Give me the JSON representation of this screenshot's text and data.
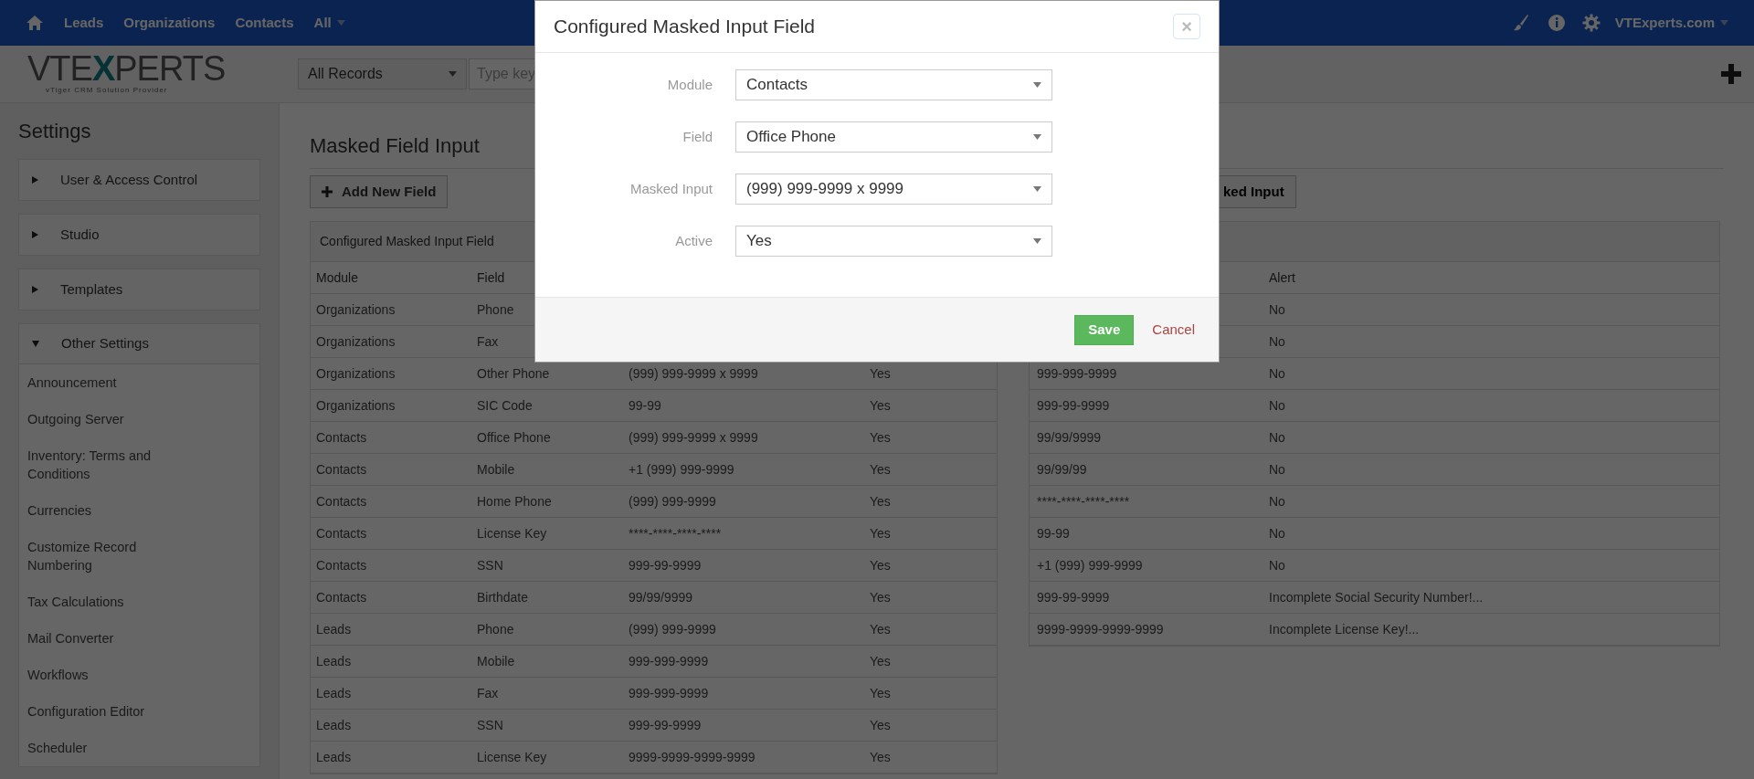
{
  "top_nav": {
    "links": [
      {
        "label": "Leads"
      },
      {
        "label": "Organizations"
      },
      {
        "label": "Contacts"
      },
      {
        "label": "All",
        "dropdown": true
      }
    ],
    "user_menu": "VTExperts.com"
  },
  "header_bar": {
    "logo": {
      "before": "VTE",
      "highlight": "X",
      "after": "PERTS",
      "tagline": "vTiger CRM Solution Provider"
    },
    "record_filter": "All Records",
    "search_placeholder": "Type key"
  },
  "sidebar": {
    "title": "Settings",
    "sections": [
      {
        "label": "User & Access Control",
        "expanded": false
      },
      {
        "label": "Studio",
        "expanded": false
      },
      {
        "label": "Templates",
        "expanded": false
      },
      {
        "label": "Other Settings",
        "expanded": true,
        "items": [
          "Announcement",
          "Outgoing Server",
          "Inventory: Terms and Conditions",
          "Currencies",
          "Customize Record Numbering",
          "Tax Calculations",
          "Mail Converter",
          "Workflows",
          "Configuration Editor",
          "Scheduler"
        ]
      }
    ]
  },
  "content": {
    "title": "Masked Field Input",
    "add_button": "Add New Field",
    "second_button": "ked Input",
    "left_table": {
      "heading": "Configured Masked Input Field",
      "columns": [
        "Module",
        "Field"
      ],
      "rows": [
        {
          "module": "Organizations",
          "field": "Phone"
        },
        {
          "module": "Organizations",
          "field": "Fax"
        },
        {
          "module": "Organizations",
          "field": "Other Phone",
          "column_3": "(999) 999-9999 x 9999",
          "column_4": "Yes"
        },
        {
          "module": "Organizations",
          "field": "SIC Code",
          "column_3": "99-99",
          "column_4": "Yes"
        },
        {
          "module": "Contacts",
          "field": "Office Phone",
          "column_3": "(999) 999-9999 x 9999",
          "column_4": "Yes"
        },
        {
          "module": "Contacts",
          "field": "Mobile",
          "column_3": "+1 (999) 999-9999",
          "column_4": "Yes"
        },
        {
          "module": "Contacts",
          "field": "Home Phone",
          "column_3": "(999) 999-9999",
          "column_4": "Yes"
        },
        {
          "module": "Contacts",
          "field": "License Key",
          "column_3": "****-****-****-****",
          "column_4": "Yes"
        },
        {
          "module": "Contacts",
          "field": "SSN",
          "column_3": "999-99-9999",
          "column_4": "Yes"
        },
        {
          "module": "Contacts",
          "field": "Birthdate",
          "column_3": "99/99/9999",
          "column_4": "Yes"
        },
        {
          "module": "Leads",
          "field": "Phone",
          "column_3": "(999) 999-9999",
          "column_4": "Yes"
        },
        {
          "module": "Leads",
          "field": "Mobile",
          "column_3": "999-999-9999",
          "column_4": "Yes"
        },
        {
          "module": "Leads",
          "field": "Fax",
          "column_3": "999-999-9999",
          "column_4": "Yes"
        },
        {
          "module": "Leads",
          "field": "SSN",
          "column_3": "999-99-9999",
          "column_4": "Yes"
        },
        {
          "module": "Leads",
          "field": "License Key",
          "column_3": "9999-9999-9999-9999",
          "column_4": "Yes"
        }
      ]
    },
    "right_table": {
      "alert_header": "Alert",
      "rows": [
        {
          "alert": "No"
        },
        {
          "alert": "No"
        },
        {
          "column_1": "999-999-9999",
          "alert": "No"
        },
        {
          "column_1": "999-99-9999",
          "alert": "No"
        },
        {
          "column_1": "99/99/9999",
          "alert": "No"
        },
        {
          "column_1": "99/99/99",
          "alert": "No"
        },
        {
          "column_1": "****-****-****-****",
          "alert": "No"
        },
        {
          "column_1": "99-99",
          "alert": "No"
        },
        {
          "column_1": "+1 (999) 999-9999",
          "alert": "No"
        },
        {
          "column_1": "999-99-9999",
          "alert": "Incomplete Social Security Number!..."
        },
        {
          "column_1": "9999-9999-9999-9999",
          "alert": "Incomplete License Key!..."
        }
      ]
    }
  },
  "modal": {
    "title": "Configured Masked Input Field",
    "close": "×",
    "fields": [
      {
        "label": "Module",
        "value": "Contacts"
      },
      {
        "label": "Field",
        "value": "Office Phone"
      },
      {
        "label": "Masked Input",
        "value": "(999) 999-9999 x 9999"
      },
      {
        "label": "Active",
        "value": "Yes"
      }
    ],
    "save": "Save",
    "cancel": "Cancel"
  }
}
